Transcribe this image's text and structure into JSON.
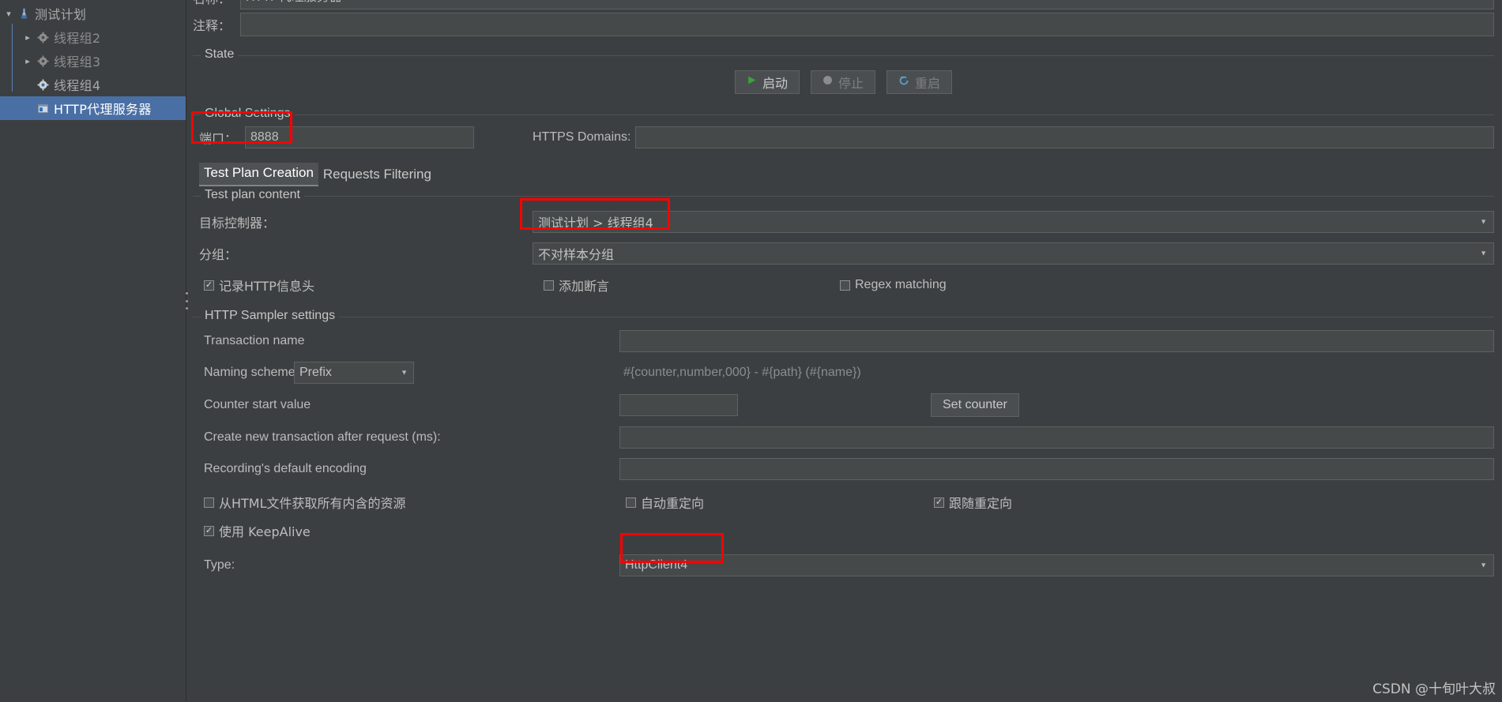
{
  "theme": {
    "background": "#3c3f41",
    "field_background": "#45494a",
    "selection_blue": "#4a6fa5",
    "annotation_red": "#ff0000",
    "text": "#bbbbbb"
  },
  "sidebar": {
    "items": [
      {
        "label": "测试计划",
        "icon": "test-plan-icon",
        "expander": "chevron-down-icon",
        "depth": 0,
        "selected": false,
        "dim": false
      },
      {
        "label": "线程组2",
        "icon": "thread-group-icon",
        "expander": "chevron-right-icon",
        "depth": 1,
        "selected": false,
        "dim": true
      },
      {
        "label": "线程组3",
        "icon": "thread-group-icon",
        "expander": "chevron-right-icon",
        "depth": 1,
        "selected": false,
        "dim": true
      },
      {
        "label": "线程组4",
        "icon": "thread-group-icon",
        "expander": "none",
        "depth": 1,
        "selected": false,
        "dim": false
      },
      {
        "label": "HTTP代理服务器",
        "icon": "http-proxy-server-icon",
        "expander": "none",
        "depth": 1,
        "selected": true,
        "dim": false
      }
    ]
  },
  "header": {
    "name_label": "名称：",
    "name_value": "HTTP代理服务器",
    "comment_label": "注释：",
    "comment_value": ""
  },
  "state_group": {
    "title": "State",
    "start_button": "启动",
    "stop_button": "停止",
    "restart_button": "重启",
    "start_icon": "play-icon",
    "stop_icon": "stop-icon",
    "restart_icon": "restart-icon"
  },
  "global_settings": {
    "title": "Global Settings",
    "port_label": "端口：",
    "port_value": "8888",
    "https_domains_label": "HTTPS Domains:",
    "https_domains_value": ""
  },
  "tabs": [
    {
      "label": "Test Plan Creation",
      "active": true
    },
    {
      "label": "Requests Filtering",
      "active": false
    }
  ],
  "test_plan_content": {
    "title": "Test plan content",
    "target_controller_label": "目标控制器：",
    "target_controller_value": "测试计划 > 线程组4",
    "grouping_label": "分组：",
    "grouping_value": "不对样本分组",
    "checkboxes": [
      {
        "label": "记录HTTP信息头",
        "checked": true
      },
      {
        "label": "添加断言",
        "checked": false
      },
      {
        "label": "Regex matching",
        "checked": false
      }
    ]
  },
  "sampler_settings": {
    "title": "HTTP Sampler settings",
    "transaction_name_label": "Transaction name",
    "transaction_name_value": "",
    "naming_scheme_label": "Naming scheme",
    "naming_scheme_value": "Prefix",
    "naming_pattern_placeholder": "#{counter,number,000} - #{path} (#{name})",
    "counter_start_label": "Counter start value",
    "counter_start_value": "",
    "set_counter_button": "Set counter",
    "create_new_transaction_label": "Create new transaction after request (ms):",
    "create_new_transaction_value": "",
    "recording_encoding_label": "Recording's default encoding",
    "recording_encoding_value": "",
    "checkboxes": [
      {
        "label": "从HTML文件获取所有内含的资源",
        "checked": false
      },
      {
        "label": "自动重定向",
        "checked": false
      },
      {
        "label": "跟随重定向",
        "checked": true
      },
      {
        "label": "使用 KeepAlive",
        "checked": true
      }
    ],
    "type_label": "Type:",
    "type_value": "HttpClient4"
  },
  "annotations": [
    {
      "name": "port-annotation"
    },
    {
      "name": "target-controller-annotation"
    },
    {
      "name": "type-annotation"
    }
  ],
  "watermark": "CSDN @十旬叶大叔"
}
